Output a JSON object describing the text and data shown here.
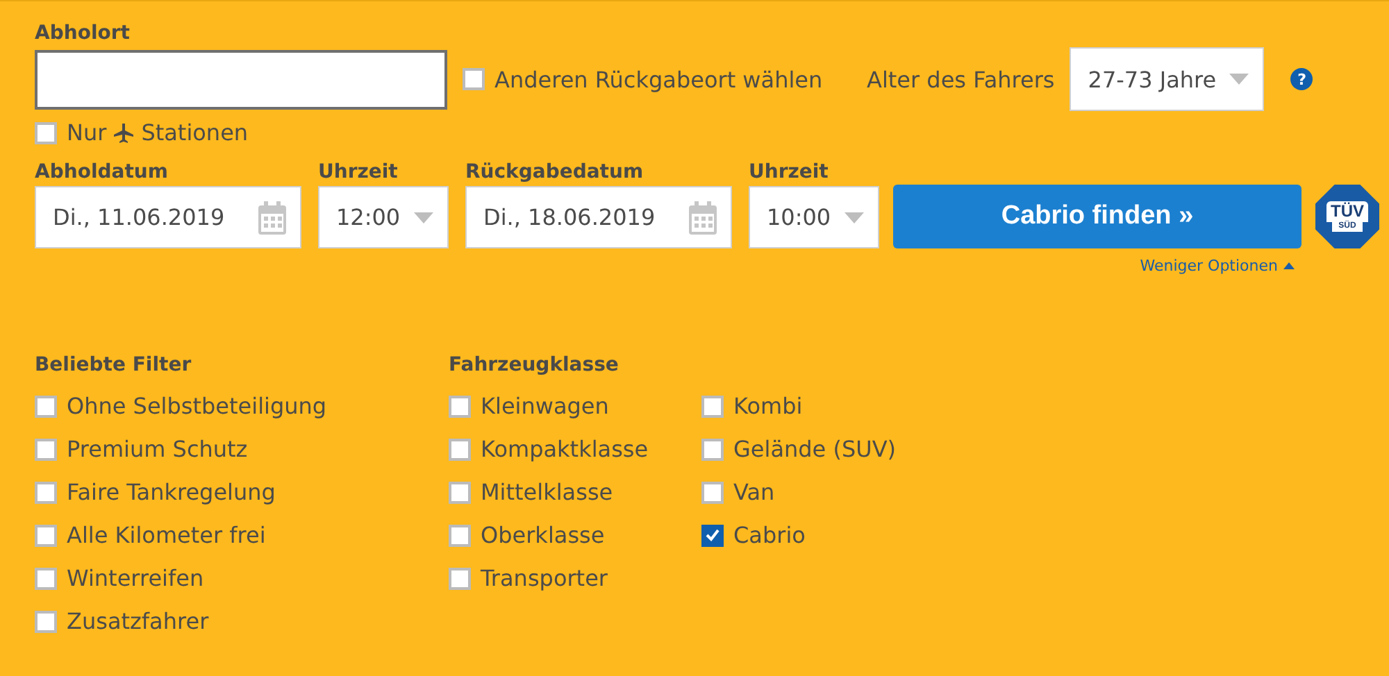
{
  "pickup": {
    "label": "Abholort"
  },
  "other_return": {
    "label": "Anderen Rückgabeort wählen",
    "checked": false
  },
  "driver_age": {
    "label": "Alter des Fahrers",
    "value": "27-73 Jahre",
    "help": "?"
  },
  "airport_only": {
    "label_before": "Nur",
    "label_after": "Stationen",
    "checked": false
  },
  "dates": [
    {
      "kind": "date",
      "label": "Abholdatum",
      "value": "Di., 11.06.2019"
    },
    {
      "kind": "time",
      "label": "Uhrzeit",
      "value": "12:00"
    },
    {
      "kind": "date",
      "label": "Rückgabedatum",
      "value": "Di., 18.06.2019"
    },
    {
      "kind": "time",
      "label": "Uhrzeit",
      "value": "10:00"
    }
  ],
  "search_button": "Cabrio finden »",
  "seal": {
    "top": "TÜV",
    "bottom": "SÜD"
  },
  "options_link": "Weniger Optionen",
  "filter_groups": [
    {
      "title": "Beliebte Filter",
      "columns": [
        [
          {
            "label": "Ohne Selbstbeteiligung",
            "checked": false
          },
          {
            "label": "Premium Schutz",
            "checked": false
          },
          {
            "label": "Faire Tankregelung",
            "checked": false
          },
          {
            "label": "Alle Kilometer frei",
            "checked": false
          },
          {
            "label": "Winterreifen",
            "checked": false
          },
          {
            "label": "Zusatzfahrer",
            "checked": false
          }
        ]
      ]
    },
    {
      "title": "Fahrzeugklasse",
      "columns": [
        [
          {
            "label": "Kleinwagen",
            "checked": false
          },
          {
            "label": "Kompaktklasse",
            "checked": false
          },
          {
            "label": "Mittelklasse",
            "checked": false
          },
          {
            "label": "Oberklasse",
            "checked": false
          },
          {
            "label": "Transporter",
            "checked": false
          }
        ],
        [
          {
            "label": "Kombi",
            "checked": false
          },
          {
            "label": "Gelände (SUV)",
            "checked": false
          },
          {
            "label": "Van",
            "checked": false
          },
          {
            "label": "Cabrio",
            "checked": true
          }
        ]
      ]
    }
  ]
}
